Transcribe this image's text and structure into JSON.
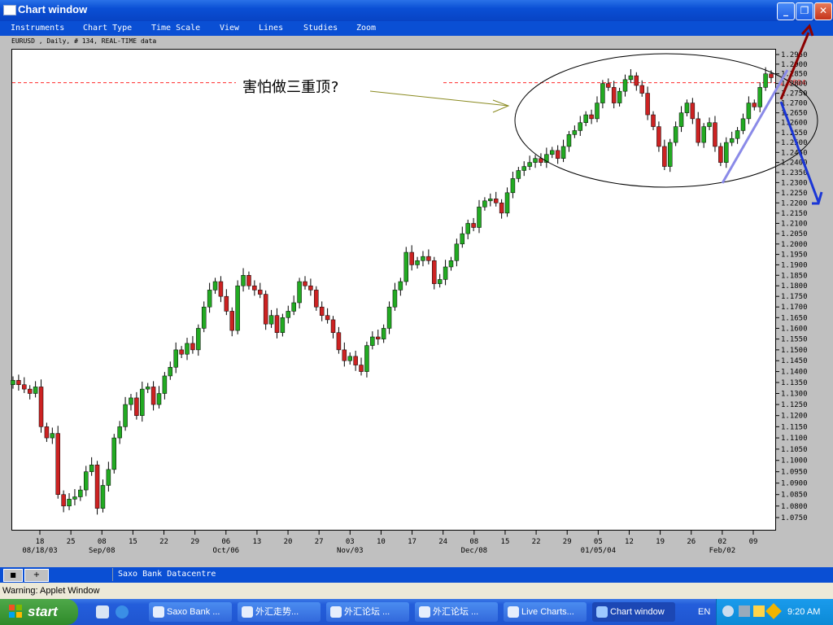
{
  "window": {
    "title": "Chart window",
    "controls": [
      "minimize",
      "restore",
      "close"
    ]
  },
  "menu": [
    "Instruments",
    "Chart Type",
    "Time Scale",
    "View",
    "Lines",
    "Studies",
    "Zoom"
  ],
  "chart": {
    "instrument_label": "EURUSD , Daily, # 134, REAL-TIME data",
    "annotation_text": "害怕做三重顶?",
    "current_price_label": "1.2804",
    "colors": {
      "up": "#22aa22",
      "down": "#cc2222",
      "hline": "#ff2a2a"
    }
  },
  "chart_data": {
    "type": "candlestick",
    "y_ticks": [
      "1.2950",
      "1.2900",
      "1.2850",
      "1.2800",
      "1.2750",
      "1.2700",
      "1.2650",
      "1.2600",
      "1.2550",
      "1.2500",
      "1.2450",
      "1.2400",
      "1.2350",
      "1.2300",
      "1.2250",
      "1.2200",
      "1.2150",
      "1.2100",
      "1.2050",
      "1.2000",
      "1.1950",
      "1.1900",
      "1.1850",
      "1.1800",
      "1.1750",
      "1.1700",
      "1.1650",
      "1.1600",
      "1.1550",
      "1.1500",
      "1.1450",
      "1.1400",
      "1.1350",
      "1.1300",
      "1.1250",
      "1.1200",
      "1.1150",
      "1.1100",
      "1.1050",
      "1.1000",
      "1.0950",
      "1.0900",
      "1.0850",
      "1.0800",
      "1.0750"
    ],
    "x_ticks": [
      {
        "day": "18",
        "month": "08/18/03"
      },
      {
        "day": "25",
        "month": ""
      },
      {
        "day": "08",
        "month": "Sep/08"
      },
      {
        "day": "15",
        "month": ""
      },
      {
        "day": "22",
        "month": ""
      },
      {
        "day": "29",
        "month": ""
      },
      {
        "day": "06",
        "month": "Oct/06"
      },
      {
        "day": "13",
        "month": ""
      },
      {
        "day": "20",
        "month": ""
      },
      {
        "day": "27",
        "month": ""
      },
      {
        "day": "03",
        "month": "Nov/03"
      },
      {
        "day": "10",
        "month": ""
      },
      {
        "day": "17",
        "month": ""
      },
      {
        "day": "24",
        "month": ""
      },
      {
        "day": "08",
        "month": "Dec/08"
      },
      {
        "day": "15",
        "month": ""
      },
      {
        "day": "22",
        "month": ""
      },
      {
        "day": "29",
        "month": ""
      },
      {
        "day": "05",
        "month": "01/05/04"
      },
      {
        "day": "12",
        "month": ""
      },
      {
        "day": "19",
        "month": ""
      },
      {
        "day": "26",
        "month": ""
      },
      {
        "day": "02",
        "month": "Feb/02"
      },
      {
        "day": "09",
        "month": ""
      }
    ],
    "horizontal_line": 1.2804,
    "closes": [
      1.136,
      1.134,
      1.132,
      1.13,
      1.133,
      1.115,
      1.11,
      1.112,
      1.085,
      1.08,
      1.083,
      1.084,
      1.087,
      1.095,
      1.098,
      1.079,
      1.089,
      1.096,
      1.11,
      1.115,
      1.125,
      1.128,
      1.12,
      1.132,
      1.133,
      1.125,
      1.13,
      1.138,
      1.142,
      1.15,
      1.148,
      1.153,
      1.15,
      1.16,
      1.17,
      1.178,
      1.182,
      1.175,
      1.168,
      1.159,
      1.18,
      1.185,
      1.18,
      1.178,
      1.176,
      1.162,
      1.166,
      1.158,
      1.165,
      1.168,
      1.172,
      1.182,
      1.18,
      1.178,
      1.17,
      1.166,
      1.164,
      1.158,
      1.15,
      1.145,
      1.147,
      1.143,
      1.14,
      1.152,
      1.156,
      1.155,
      1.16,
      1.17,
      1.178,
      1.182,
      1.196,
      1.19,
      1.192,
      1.194,
      1.192,
      1.181,
      1.183,
      1.189,
      1.192,
      1.2,
      1.205,
      1.21,
      1.208,
      1.218,
      1.221,
      1.222,
      1.22,
      1.215,
      1.225,
      1.232,
      1.236,
      1.238,
      1.24,
      1.242,
      1.24,
      1.244,
      1.246,
      1.242,
      1.248,
      1.254,
      1.256,
      1.26,
      1.264,
      1.262,
      1.27,
      1.28,
      1.278,
      1.27,
      1.276,
      1.282,
      1.284,
      1.279,
      1.275,
      1.264,
      1.258,
      1.248,
      1.238,
      1.25,
      1.258,
      1.265,
      1.27,
      1.262,
      1.25,
      1.258,
      1.26,
      1.248,
      1.24,
      1.25,
      1.252,
      1.256,
      1.262,
      1.27,
      1.268,
      1.278,
      1.285,
      1.283
    ]
  },
  "status": {
    "datacentre": "Saxo Bank Datacentre",
    "warning": "Warning: Applet Window"
  },
  "taskbar": {
    "start_label": "start",
    "items": [
      {
        "label": "Saxo Bank ...",
        "active": false
      },
      {
        "label": "外汇走势...",
        "active": false
      },
      {
        "label": "外汇论坛 ...",
        "active": false
      },
      {
        "label": "外汇论坛 ...",
        "active": false
      },
      {
        "label": "Live Charts...",
        "active": false
      },
      {
        "label": "Chart window",
        "active": true
      }
    ],
    "language": "EN",
    "clock": "9:20 AM"
  }
}
